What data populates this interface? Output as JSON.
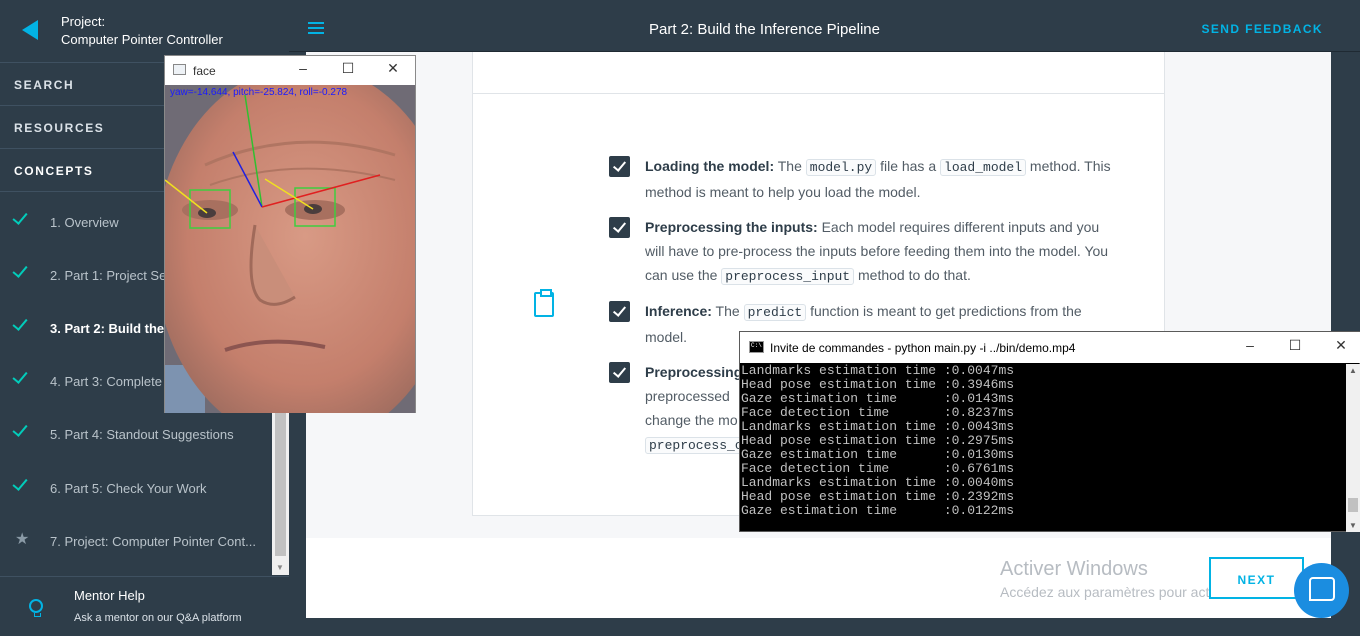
{
  "sidebar": {
    "project_label": "Project:",
    "project_name": "Computer Pointer Controller",
    "sections": {
      "search": "SEARCH",
      "resources": "RESOURCES",
      "concepts": "CONCEPTS"
    },
    "items": [
      {
        "label": "1. Overview",
        "status": "done"
      },
      {
        "label": "2. Part 1: Project Se",
        "status": "done"
      },
      {
        "label": "3. Part 2: Build the",
        "status": "done"
      },
      {
        "label": "4. Part 3: Complete",
        "status": "done"
      },
      {
        "label": "5. Part 4: Standout Suggestions",
        "status": "done"
      },
      {
        "label": "6. Part 5: Check Your Work",
        "status": "done"
      },
      {
        "label": "7. Project: Computer Pointer Cont...",
        "status": "project"
      }
    ],
    "mentor": {
      "title": "Mentor Help",
      "subtitle": "Ask a mentor on our Q&A platform"
    }
  },
  "topbar": {
    "title": "Part 2: Build the Inference Pipeline",
    "feedback": "SEND FEEDBACK"
  },
  "content": {
    "items": [
      {
        "title": "Loading the model:",
        "t1": " The ",
        "c1": "model.py",
        "t2": " file has a ",
        "c2": "load_model",
        "t3": " method. This method is meant to help you load the model."
      },
      {
        "title": "Preprocessing the inputs:",
        "t1": " Each model requires different inputs and you will have to pre-process the inputs before feeding them into the model. You can use the ",
        "c1": "preprocess_input",
        "t2": " method to do that."
      },
      {
        "title": "Inference:",
        "t1": " The ",
        "c1": "predict",
        "t2": " function is meant to get predictions from the model."
      },
      {
        "title": "Preprocessing",
        "line2": "preprocessed",
        "line3": "change the mo",
        "c1": "preprocess_o"
      }
    ],
    "next_label": "NEXT"
  },
  "watermark": {
    "title": "Activer Windows",
    "subtitle": "Accédez aux paramètres pour activer Windows."
  },
  "face_window": {
    "title": "face",
    "readout": "yaw=-14.644, pitch=-25.824, roll=-0.278"
  },
  "cmd_window": {
    "title": "Invite de commandes - python  main.py -i ../bin/demo.mp4",
    "lines": [
      "Landmarks estimation time :0.0047ms",
      "Head pose estimation time :0.3946ms",
      "Gaze estimation time      :0.0143ms",
      "Face detection time       :0.8237ms",
      "Landmarks estimation time :0.0043ms",
      "Head pose estimation time :0.2975ms",
      "Gaze estimation time      :0.0130ms",
      "Face detection time       :0.6761ms",
      "Landmarks estimation time :0.0040ms",
      "Head pose estimation time :0.2392ms",
      "Gaze estimation time      :0.0122ms"
    ]
  },
  "colors": {
    "accent": "#02b3e4",
    "sidebar": "#2e3d49",
    "check": "#02ccba"
  }
}
